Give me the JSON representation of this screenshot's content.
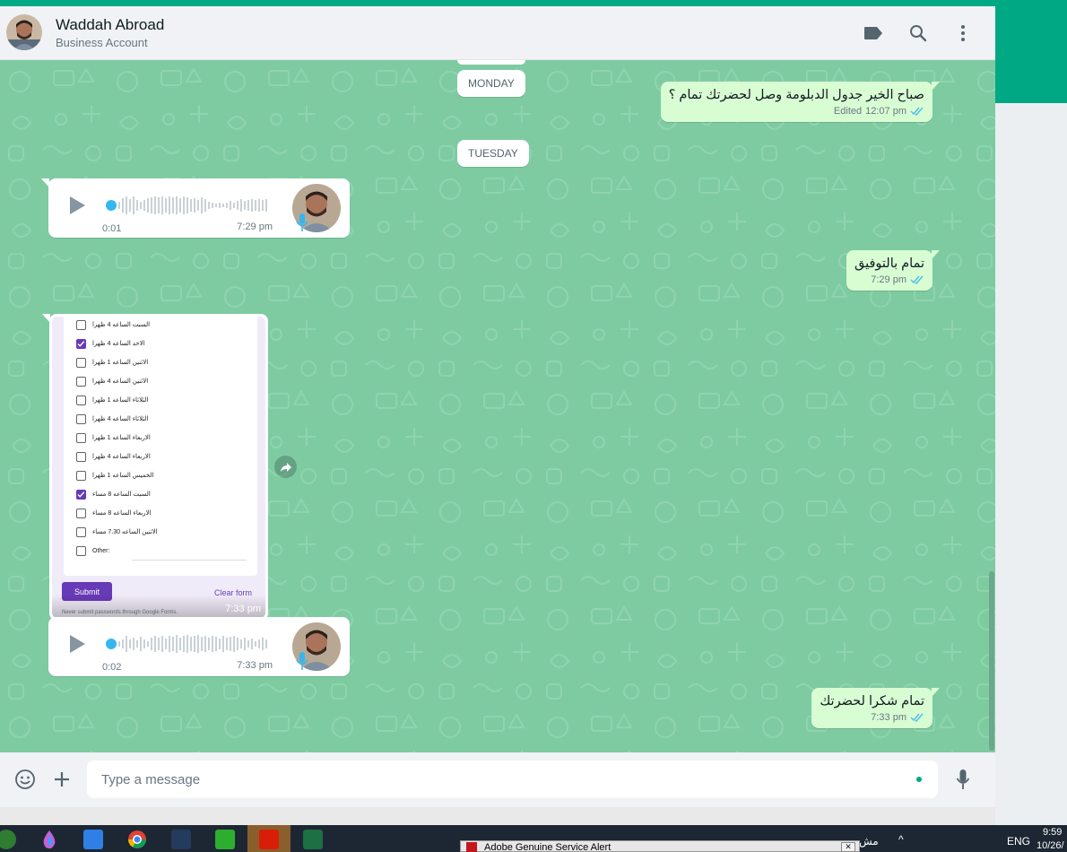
{
  "header": {
    "contact_name": "Waddah Abroad",
    "contact_sub": "Business Account"
  },
  "days": [
    "MONDAY",
    "TUESDAY"
  ],
  "messages": {
    "m1": {
      "text": "صباح الخير جدول الدبلومة وصل لحضرتك تمام ؟",
      "status": "Edited",
      "time": "12:07 pm"
    },
    "m2": {
      "text": "تمام بالتوفيق",
      "time": "7:29 pm"
    },
    "m3": {
      "text": "تمام شكرا لحضرتك",
      "time": "7:33 pm"
    }
  },
  "voice_notes": [
    {
      "duration": "0:01",
      "time": "7:29 pm"
    },
    {
      "duration": "0:02",
      "time": "7:33 pm"
    }
  ],
  "form_image": {
    "options": [
      {
        "label": "السبت الساعه 4 ظهرا",
        "checked": false
      },
      {
        "label": "الاحد الساعه 4 ظهرا",
        "checked": true
      },
      {
        "label": "الاثنين الساعه 1 ظهرا",
        "checked": false
      },
      {
        "label": "الاثنين الساعه 4 ظهرا",
        "checked": false
      },
      {
        "label": "الثلاثاء الساعه 1 ظهرا",
        "checked": false
      },
      {
        "label": "الثلاثاء الساعه 4 ظهرا",
        "checked": false
      },
      {
        "label": "الاربعاء الساعه 1 ظهرا",
        "checked": false
      },
      {
        "label": "الاربعاء الساعه 4 ظهرا",
        "checked": false
      },
      {
        "label": "الخميس الساعه 1 ظهرا",
        "checked": false
      },
      {
        "label": "السبت الساعه 8 مساء",
        "checked": true
      },
      {
        "label": "الاربعاء الساعه 8 مساء",
        "checked": false
      },
      {
        "label": "الاثنين الساعه 7.30 مساء",
        "checked": false
      },
      {
        "label": "Other:",
        "checked": false
      }
    ],
    "submit_label": "Submit",
    "clear_label": "Clear form",
    "footer_note": "Never submit passwords through Google Forms.",
    "time": "7:33 pm"
  },
  "composer": {
    "placeholder": "Type a message"
  },
  "taskbar": {
    "alert_title": "Adobe Genuine Service Alert",
    "tray_partial": "مش",
    "language": "ENG",
    "clock_time": "9:59",
    "clock_date": "10/26/"
  },
  "colors": {
    "brand_green": "#00a884",
    "chat_background": "#7ecba2",
    "outgoing_bubble": "#d9fdd3",
    "form_purple": "#673ab7"
  },
  "icons": [
    "labels-icon",
    "search-icon",
    "menu-icon",
    "play-icon",
    "mic-icon",
    "forward-icon",
    "emoji-icon",
    "attach-icon",
    "voice-record-icon",
    "double-check-icon"
  ]
}
